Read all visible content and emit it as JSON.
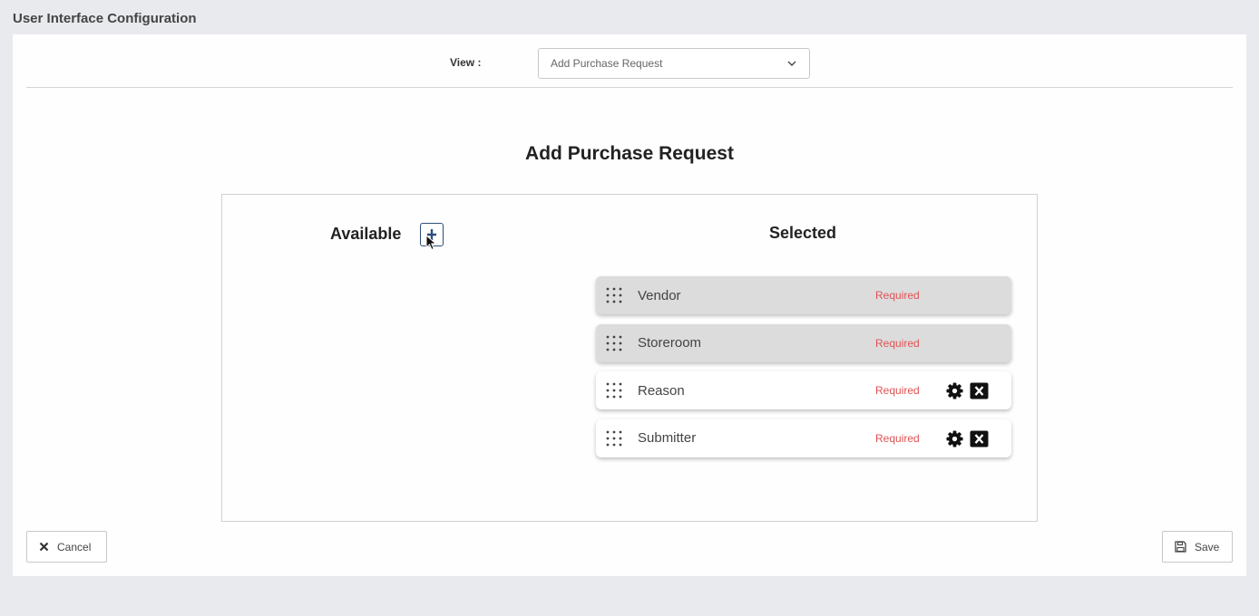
{
  "page": {
    "title": "User Interface Configuration"
  },
  "view": {
    "label": "View :",
    "selected": "Add Purchase Request"
  },
  "section": {
    "title": "Add Purchase Request"
  },
  "available": {
    "title": "Available"
  },
  "selected": {
    "title": "Selected",
    "items": [
      {
        "name": "Vendor",
        "tag": "Required",
        "locked": true
      },
      {
        "name": "Storeroom",
        "tag": "Required",
        "locked": true
      },
      {
        "name": "Reason",
        "tag": "Required",
        "locked": false
      },
      {
        "name": "Submitter",
        "tag": "Required",
        "locked": false
      }
    ]
  },
  "footer": {
    "cancel_label": "Cancel",
    "save_label": "Save"
  },
  "colors": {
    "required": "#e05252",
    "add_button": "#2c4f7c",
    "locked_item_bg": "#dcdcdd"
  },
  "icons": [
    "add-icon",
    "chevron-down-icon",
    "drag-handle-icon",
    "gear-icon",
    "remove-icon",
    "cancel-icon",
    "save-icon",
    "cursor-icon"
  ]
}
